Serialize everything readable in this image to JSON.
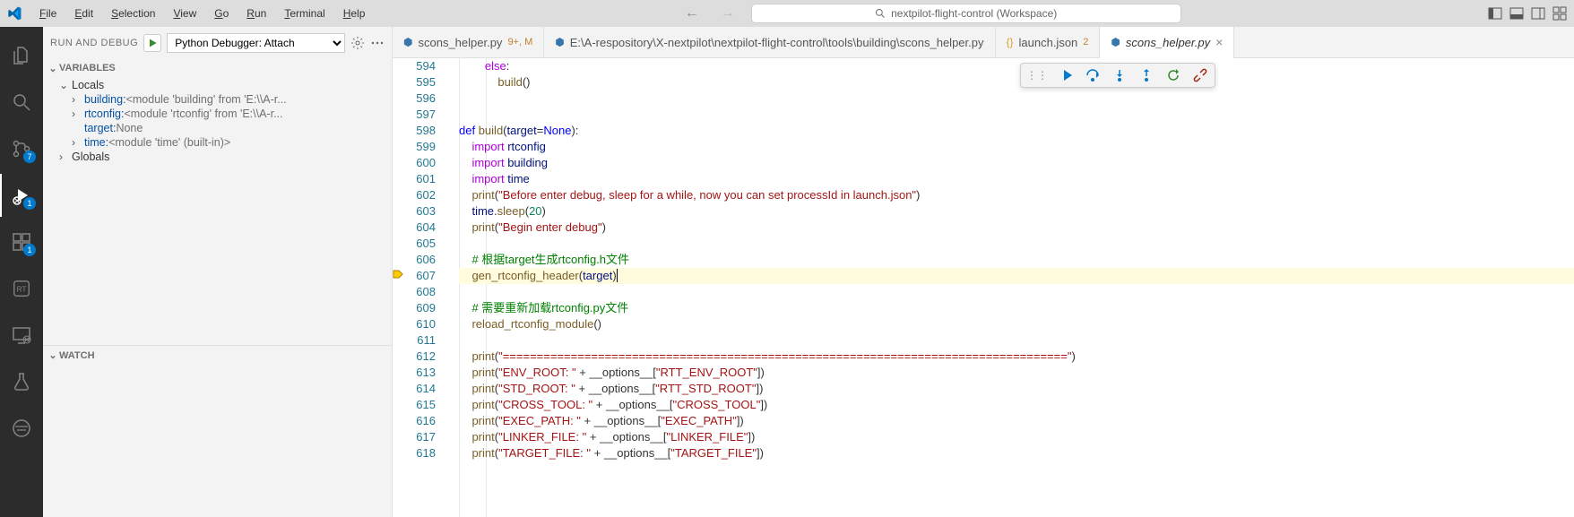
{
  "titlebar": {
    "menus": [
      "File",
      "Edit",
      "Selection",
      "View",
      "Go",
      "Run",
      "Terminal",
      "Help"
    ],
    "workspace": "nextpilot-flight-control (Workspace)"
  },
  "activity": {
    "scm_badge": "7",
    "debug_badge": "1",
    "ext_badge": "1"
  },
  "sidebar": {
    "title": "RUN AND DEBUG",
    "launch_config": "Python Debugger: Attach",
    "sections": {
      "variables": "VARIABLES",
      "locals": "Locals",
      "globals": "Globals",
      "watch": "WATCH"
    },
    "vars": {
      "building_key": "building:",
      "building_val": " <module 'building' from 'E:\\\\A-r...",
      "rtconfig_key": "rtconfig:",
      "rtconfig_val": " <module 'rtconfig' from 'E:\\\\A-r...",
      "target_key": "target:",
      "target_val": " None",
      "time_key": "time:",
      "time_val": " <module 'time' (built-in)>"
    }
  },
  "tabs": [
    {
      "icon": "py",
      "label": "scons_helper.py",
      "suffix": "9+, M"
    },
    {
      "icon": "py",
      "label": "E:\\A-respository\\X-nextpilot\\nextpilot-flight-control\\tools\\building\\scons_helper.py",
      "suffix": ""
    },
    {
      "icon": "json",
      "label": "launch.json",
      "suffix": "2"
    },
    {
      "icon": "py",
      "label": "scons_helper.py",
      "suffix": "",
      "active": true,
      "close": true
    }
  ],
  "code": {
    "lines": [
      594,
      595,
      596,
      597,
      598,
      599,
      600,
      601,
      602,
      603,
      604,
      605,
      606,
      607,
      608,
      609,
      610,
      611,
      612,
      613,
      614,
      615,
      616,
      617,
      618
    ],
    "l594": "        else:",
    "l595": "            build()",
    "l597": "",
    "l598": "def build(target=None):",
    "l599": "    import rtconfig",
    "l600": "    import building",
    "l601": "    import time",
    "l602_a": "    print(",
    "l602_s": "\"Before enter debug, sleep for a while, now you can set processId in launch.json\"",
    "l602_b": ")",
    "l603_a": "    time.sleep(",
    "l603_n": "20",
    "l603_b": ")",
    "l604_a": "    print(",
    "l604_s": "\"Begin enter debug\"",
    "l604_b": ")",
    "l606": "    # 根据target生成rtconfig.h文件",
    "l607": "    gen_rtconfig_header(target)",
    "l609": "    # 需要重新加载rtconfig.py文件",
    "l610": "    reload_rtconfig_module()",
    "l612_a": "    print(",
    "l612_s": "\"===================================================================================\"",
    "l612_b": ")",
    "l613_a": "    print(",
    "l613_s1": "\"ENV_ROOT: \"",
    "l613_m": " + __options__[",
    "l613_s2": "\"RTT_ENV_ROOT\"",
    "l613_b": "])",
    "l614_a": "    print(",
    "l614_s1": "\"STD_ROOT: \"",
    "l614_m": " + __options__[",
    "l614_s2": "\"RTT_STD_ROOT\"",
    "l614_b": "])",
    "l615_a": "    print(",
    "l615_s1": "\"CROSS_TOOL: \"",
    "l615_m": " + __options__[",
    "l615_s2": "\"CROSS_TOOL\"",
    "l615_b": "])",
    "l616_a": "    print(",
    "l616_s1": "\"EXEC_PATH: \"",
    "l616_m": " + __options__[",
    "l616_s2": "\"EXEC_PATH\"",
    "l616_b": "])",
    "l617_a": "    print(",
    "l617_s1": "\"LINKER_FILE: \"",
    "l617_m": " + __options__[",
    "l617_s2": "\"LINKER_FILE\"",
    "l617_b": "])",
    "l618_a": "    print(",
    "l618_s1": "\"TARGET_FILE: \"",
    "l618_m": " + __options__[",
    "l618_s2": "\"TARGET_FILE\"",
    "l618_b": "])"
  }
}
